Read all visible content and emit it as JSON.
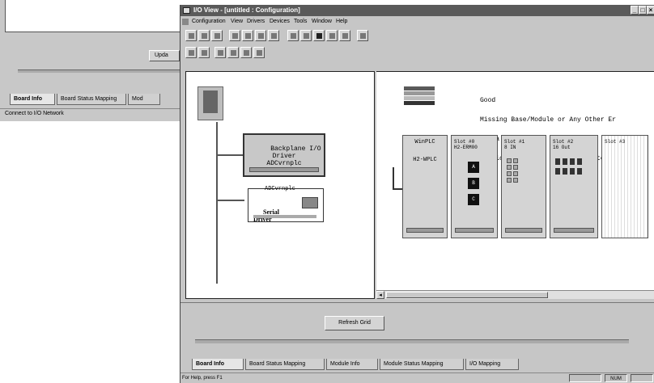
{
  "background_window": {
    "button_label": "Upda",
    "tabs": [
      "Board Info",
      "Board Status Mapping",
      "Mod"
    ],
    "status": "Connect to I/O Network"
  },
  "window": {
    "title": "I/O View - [untitled : Configuration]",
    "controls": [
      "_",
      "□",
      "×"
    ]
  },
  "menu": [
    "Configuration",
    "View",
    "Drivers",
    "Devices",
    "Tools",
    "Window",
    "Help"
  ],
  "toolbar": {
    "row1_icons": [
      "new-icon",
      "open-icon",
      "save-icon",
      "cut-icon",
      "copy-icon",
      "paste-icon",
      "print-icon",
      "module-icon",
      "base-icon",
      "monitor-icon",
      "properties-icon",
      "tools-icon",
      "help-icon"
    ],
    "row2_icons": [
      "tile-icon",
      "cascade-icon",
      "zoom-in-icon",
      "zoom-out-icon",
      "fit-icon",
      "grid-icon"
    ]
  },
  "tree": {
    "node_backplane": "Backplane I/O\nDriver\nADCvrnplc",
    "node_serial_label": "ADCvrnplc",
    "node_serial": "Serial\nDriver"
  },
  "legend": {
    "items": [
      "Good",
      "Missing Base/Module or Any Other Er",
      "Extra Base/Module",
      "Duplicate Base or Module Mismatch"
    ],
    "colors": [
      "#5a5a5a",
      "#999999",
      "#bbbbbb",
      "#333333"
    ]
  },
  "rack": {
    "cpu_title": "WinPLC",
    "cpu_sub": "H2-WPLC",
    "slots": [
      {
        "title": "Slot #0",
        "sub": "H2-ERM00"
      },
      {
        "title": "Slot #1",
        "sub": "8 IN"
      },
      {
        "title": "Slot #2",
        "sub": "16 Out"
      },
      {
        "title": "Slot #3",
        "sub": ""
      }
    ],
    "slot0_buttons": [
      "A",
      "B",
      "C"
    ]
  },
  "bottom": {
    "refresh_label": "Refresh Grid",
    "tabs": [
      "Board Info",
      "Board Status Mapping",
      "Module Info",
      "Module Status Mapping",
      "I/O Mapping"
    ]
  },
  "statusbar": {
    "text": "For Help, press F1",
    "num": "NUM"
  }
}
